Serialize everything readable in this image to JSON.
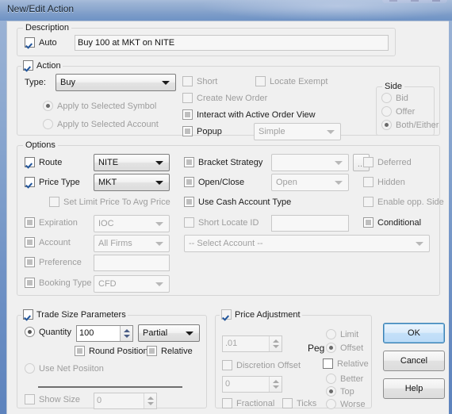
{
  "window": {
    "title": "New/Edit Action"
  },
  "description": {
    "group_label": "Description",
    "auto_label": "Auto",
    "auto_checked": true,
    "text_value": "Buy 100 at MKT on NITE"
  },
  "action": {
    "group_label": "Action",
    "group_checked": true,
    "type_label": "Type:",
    "type_value": "Buy",
    "apply_symbol_label": "Apply to Selected Symbol",
    "apply_account_label": "Apply to Selected Account",
    "short_label": "Short",
    "locate_exempt_label": "Locate Exempt",
    "create_new_order_label": "Create New Order",
    "interact_label": "Interact with Active Order View",
    "popup_label": "Popup",
    "popup_combo_value": "Simple",
    "side": {
      "group_label": "Side",
      "bid_label": "Bid",
      "offer_label": "Offer",
      "both_label": "Both/Either"
    }
  },
  "options": {
    "group_label": "Options",
    "route_label": "Route",
    "route_value": "NITE",
    "price_type_label": "Price Type",
    "price_type_value": "MKT",
    "set_limit_label": "Set Limit Price To Avg Price",
    "expiration_label": "Expiration",
    "expiration_value": "IOC",
    "account_label": "Account",
    "account_value": "All Firms",
    "preference_label": "Preference",
    "preference_value": "",
    "booking_type_label": "Booking Type",
    "booking_type_value": "CFD",
    "bracket_strategy_label": "Bracket Strategy",
    "bracket_strategy_value": "",
    "bracket_browse_label": "...",
    "open_close_label": "Open/Close",
    "open_close_value": "Open",
    "use_cash_label": "Use Cash Account Type",
    "short_locate_label": "Short Locate ID",
    "short_locate_value": "",
    "deferred_label": "Deferred",
    "hidden_label": "Hidden",
    "enable_opp_label": "Enable opp. Side",
    "conditional_label": "Conditional",
    "select_account_value": "-- Select Account --"
  },
  "trade_size": {
    "group_label": "Trade Size Parameters",
    "group_checked": true,
    "quantity_label": "Quantity",
    "quantity_value": "100",
    "partial_value": "Partial",
    "round_position_label": "Round Position",
    "relative_label": "Relative",
    "use_net_label": "Use Net Posiiton",
    "show_size_label": "Show Size",
    "show_size_value": "0"
  },
  "price_adjustment": {
    "group_label": "Price Adjustment",
    "group_checked": true,
    "offset_value": ".01",
    "peg_label": "Peg",
    "limit_label": "Limit",
    "offset_label": "Offset",
    "discretion_label": "Discretion Offset",
    "discretion_value": "0",
    "relative_label": "Relative",
    "better_label": "Better",
    "top_label": "Top",
    "worse_label": "Worse",
    "fractional_label": "Fractional",
    "ticks_label": "Ticks"
  },
  "buttons": {
    "ok_label": "OK",
    "cancel_label": "Cancel",
    "help_label": "Help"
  }
}
